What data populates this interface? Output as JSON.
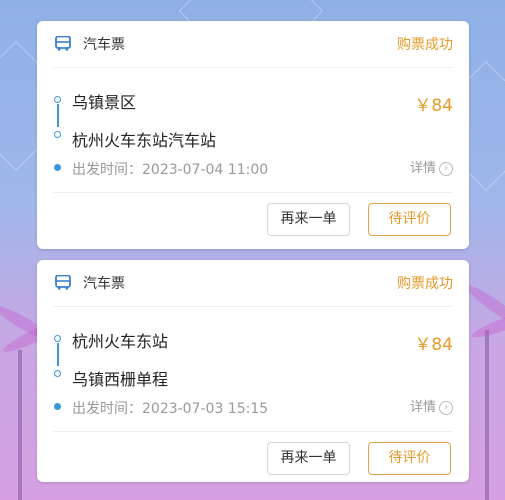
{
  "orders": [
    {
      "type_label": "汽车票",
      "status": "购票成功",
      "from": "乌镇景区",
      "to": "杭州火车东站汽车站",
      "price": "￥84",
      "departure": "出发时间：2023-07-04 11:00",
      "detail_label": "详情",
      "rebook_label": "再来一单",
      "review_label": "待评价"
    },
    {
      "type_label": "汽车票",
      "status": "购票成功",
      "from": "杭州火车东站",
      "to": "乌镇西栅单程",
      "price": "￥84",
      "departure": "出发时间：2023-07-03 15:15",
      "detail_label": "详情",
      "rebook_label": "再来一单",
      "review_label": "待评价"
    }
  ],
  "colors": {
    "accent": "#e69a28",
    "route_blue": "#3a9ad9"
  },
  "icons": [
    "bus-icon",
    "chevron-right-icon"
  ]
}
